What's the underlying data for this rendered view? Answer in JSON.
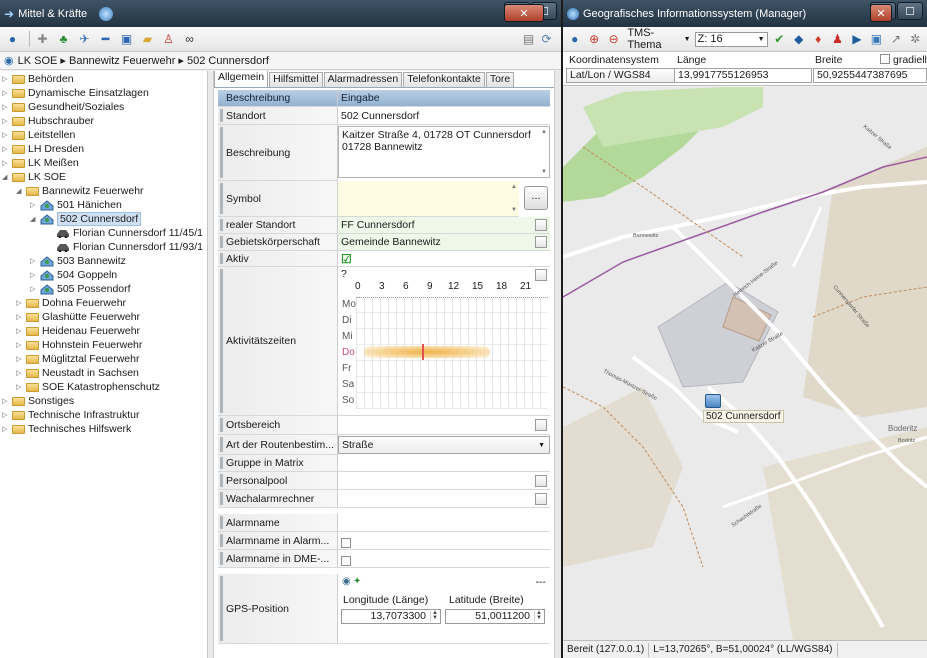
{
  "left_window": {
    "title": "Mittel & Kräfte",
    "breadcrumb": "LK SOE ▸ Bannewitz Feuerwehr ▸ 502 Cunnersdorf",
    "tree": [
      {
        "label": "Behörden"
      },
      {
        "label": "Dynamische Einsatzlagen"
      },
      {
        "label": "Gesundheit/Soziales"
      },
      {
        "label": "Hubschrauber"
      },
      {
        "label": "Leitstellen"
      },
      {
        "label": "LH Dresden"
      },
      {
        "label": "LK Meißen"
      },
      {
        "label": "LK SOE"
      },
      {
        "label": "Bannewitz Feuerwehr"
      },
      {
        "label": "501 Hänichen"
      },
      {
        "label": "502 Cunnersdorf"
      },
      {
        "label": "Florian Cunnersdorf 11/45/1"
      },
      {
        "label": "Florian Cunnersdorf 11/93/1"
      },
      {
        "label": "503 Bannewitz"
      },
      {
        "label": "504 Goppeln"
      },
      {
        "label": "505 Possendorf"
      },
      {
        "label": "Dohna Feuerwehr"
      },
      {
        "label": "Glashütte Feuerwehr"
      },
      {
        "label": "Heidenau Feuerwehr"
      },
      {
        "label": "Hohnstein Feuerwehr"
      },
      {
        "label": "Müglitztal Feuerwehr"
      },
      {
        "label": "Neustadt in Sachsen"
      },
      {
        "label": "SOE Katastrophenschutz"
      },
      {
        "label": "Sonstiges"
      },
      {
        "label": "Technische Infrastruktur"
      },
      {
        "label": "Technisches Hilfswerk"
      }
    ],
    "tabs": [
      "Allgemein",
      "Hilfsmittel",
      "Alarmadressen",
      "Telefonkontakte",
      "Tore"
    ],
    "form": {
      "header_label": "Beschreibung",
      "header_value": "Eingabe",
      "standort_label": "Standort",
      "standort_value": "502 Cunnersdorf",
      "beschreibung_label": "Beschreibung",
      "beschreibung_line1": "Kaitzer Straße 4, 01728 OT Cunnersdorf",
      "beschreibung_line2": "01728 Bannewitz",
      "symbol_label": "Symbol",
      "symbol_button": "...",
      "realer_label": "realer Standort",
      "realer_value": "FF Cunnersdorf",
      "gebiet_label": "Gebietskörperschaft",
      "gebiet_value": "Gemeinde Bannewitz",
      "aktiv_label": "Aktiv",
      "aktivzeit_label": "Aktivitätszeiten",
      "aktivzeit_q": "?",
      "hours": [
        "0",
        "3",
        "6",
        "9",
        "12",
        "15",
        "18",
        "21"
      ],
      "days": [
        "Mo",
        "Di",
        "Mi",
        "Do",
        "Fr",
        "Sa",
        "So"
      ],
      "ortsbereich_label": "Ortsbereich",
      "route_label": "Art der Routenbestim...",
      "route_value": "Straße",
      "gruppe_label": "Gruppe in Matrix",
      "personal_label": "Personalpool",
      "wache_label": "Wachalarmrechner",
      "alarmname_label": "Alarmname",
      "alarm_in_alarm_label": "Alarmname in Alarm...",
      "alarm_in_dme_label": "Alarmname in DME-...",
      "gps_label": "GPS-Position",
      "gps_lon_label": "Longitude (Länge)",
      "gps_lat_label": "Latitude (Breite)",
      "gps_lon": "13,7073300",
      "gps_lat": "51,0011200",
      "gps_dash": "---"
    }
  },
  "right_window": {
    "title": "Geografisches Informationssystem (Manager)",
    "theme": "TMS-Thema",
    "zoom": "Z: 16",
    "coord_label": "Koordinatensystem",
    "coord_value": "Lat/Lon / WGS84",
    "laenge_label": "Länge",
    "laenge_value": "13,9917755126953",
    "breite_label": "Breite",
    "breite_value": "50,9255447387695",
    "gradient_label": "gradiell",
    "map_marker": "502 Cunnersdorf",
    "map_place": "Boderitz",
    "roads": {
      "r1": "Bannewitz",
      "r2": "Heinrich-Heine-Straße",
      "r3": "Kaitzer Straße",
      "r4": "Thomas-Müntzer-Straße",
      "r5": "Kaitzer Straße",
      "r6": "Cunnersdorfer Straße",
      "r7": "Schachtstraße",
      "r8": "Bodritz"
    },
    "status_left": "Bereit (127.0.0.1)",
    "status_right": "L=13,70265°, B=51,00024° (LL/WGS84)"
  }
}
